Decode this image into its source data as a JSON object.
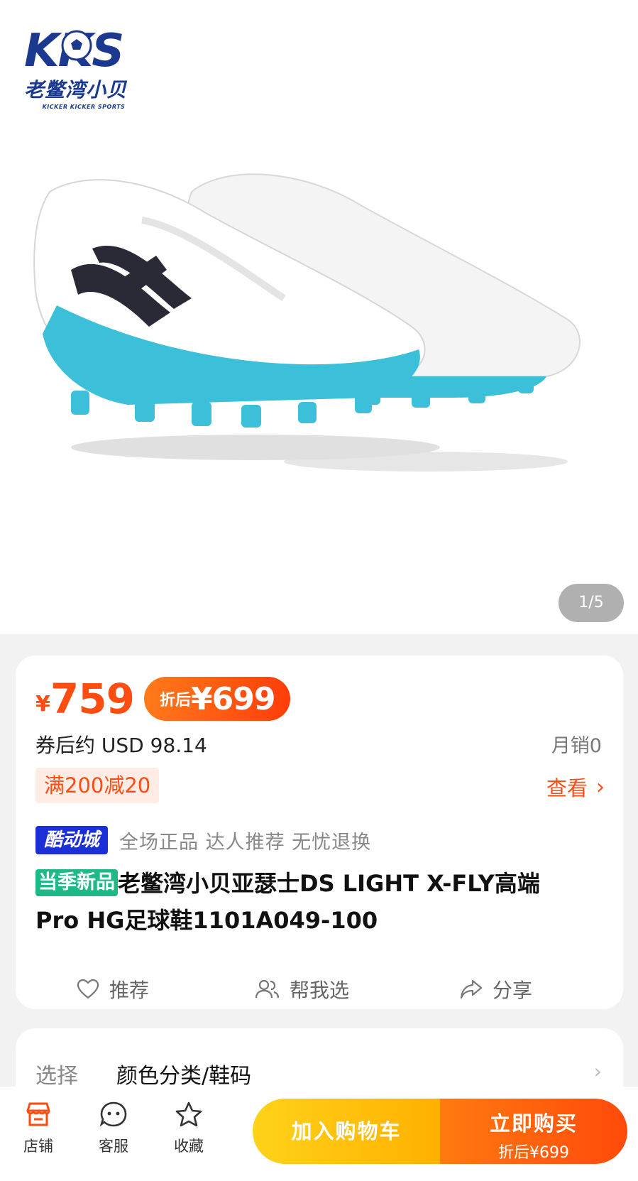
{
  "gallery": {
    "logo_text": "KKS",
    "logo_cn": "老鳖湾小贝",
    "logo_sub": "KICKER KICKER SPORTS",
    "counter": "1/5"
  },
  "price": {
    "currency": "¥",
    "value": "759",
    "discount_label": "折后",
    "discount_value": "¥699",
    "usd": "券后约 USD 98.14",
    "monthly_sales": "月销0",
    "coupon": "满200减20",
    "view": "查看"
  },
  "store": {
    "badge": "酷动城",
    "tags": "全场正品 达人推荐 无忧退换"
  },
  "product": {
    "new_badge": "当季新品",
    "title": "老鳖湾小贝亚瑟士DS LIGHT X-FLY高端Pro HG足球鞋1101A049-100"
  },
  "actions": {
    "recommend": "推荐",
    "help_choose": "帮我选",
    "share": "分享"
  },
  "selection": {
    "label": "选择",
    "value": "颜色分类/鞋码"
  },
  "bottom_nav": {
    "shop": "店铺",
    "service": "客服",
    "favorite": "收藏",
    "add_to_cart": "加入购物车",
    "buy_now": "立即购买",
    "buy_price": "折后¥699"
  },
  "colors": {
    "accent": "#ff4d12",
    "cart_yellow": "#ffc107",
    "new_badge_green": "#1fb887",
    "store_blue": "#1b2fd6"
  }
}
